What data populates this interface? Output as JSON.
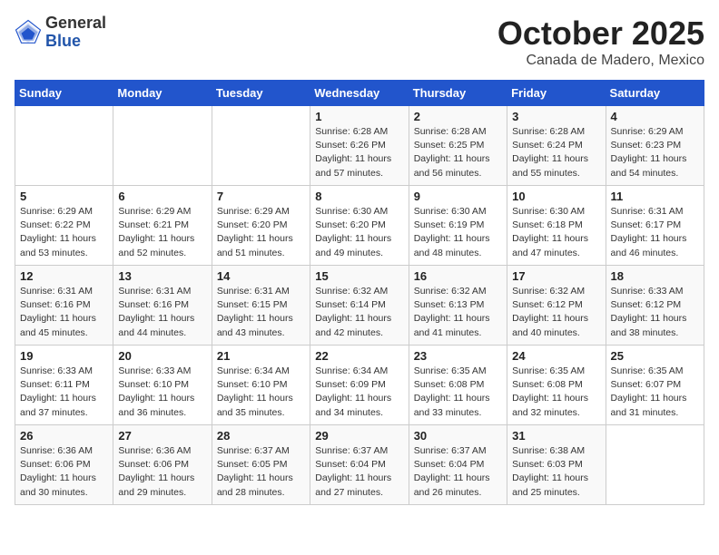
{
  "header": {
    "logo_general": "General",
    "logo_blue": "Blue",
    "month_title": "October 2025",
    "location": "Canada de Madero, Mexico"
  },
  "days_of_week": [
    "Sunday",
    "Monday",
    "Tuesday",
    "Wednesday",
    "Thursday",
    "Friday",
    "Saturday"
  ],
  "weeks": [
    [
      {
        "day": "",
        "info": ""
      },
      {
        "day": "",
        "info": ""
      },
      {
        "day": "",
        "info": ""
      },
      {
        "day": "1",
        "info": "Sunrise: 6:28 AM\nSunset: 6:26 PM\nDaylight: 11 hours and 57 minutes."
      },
      {
        "day": "2",
        "info": "Sunrise: 6:28 AM\nSunset: 6:25 PM\nDaylight: 11 hours and 56 minutes."
      },
      {
        "day": "3",
        "info": "Sunrise: 6:28 AM\nSunset: 6:24 PM\nDaylight: 11 hours and 55 minutes."
      },
      {
        "day": "4",
        "info": "Sunrise: 6:29 AM\nSunset: 6:23 PM\nDaylight: 11 hours and 54 minutes."
      }
    ],
    [
      {
        "day": "5",
        "info": "Sunrise: 6:29 AM\nSunset: 6:22 PM\nDaylight: 11 hours and 53 minutes."
      },
      {
        "day": "6",
        "info": "Sunrise: 6:29 AM\nSunset: 6:21 PM\nDaylight: 11 hours and 52 minutes."
      },
      {
        "day": "7",
        "info": "Sunrise: 6:29 AM\nSunset: 6:20 PM\nDaylight: 11 hours and 51 minutes."
      },
      {
        "day": "8",
        "info": "Sunrise: 6:30 AM\nSunset: 6:20 PM\nDaylight: 11 hours and 49 minutes."
      },
      {
        "day": "9",
        "info": "Sunrise: 6:30 AM\nSunset: 6:19 PM\nDaylight: 11 hours and 48 minutes."
      },
      {
        "day": "10",
        "info": "Sunrise: 6:30 AM\nSunset: 6:18 PM\nDaylight: 11 hours and 47 minutes."
      },
      {
        "day": "11",
        "info": "Sunrise: 6:31 AM\nSunset: 6:17 PM\nDaylight: 11 hours and 46 minutes."
      }
    ],
    [
      {
        "day": "12",
        "info": "Sunrise: 6:31 AM\nSunset: 6:16 PM\nDaylight: 11 hours and 45 minutes."
      },
      {
        "day": "13",
        "info": "Sunrise: 6:31 AM\nSunset: 6:16 PM\nDaylight: 11 hours and 44 minutes."
      },
      {
        "day": "14",
        "info": "Sunrise: 6:31 AM\nSunset: 6:15 PM\nDaylight: 11 hours and 43 minutes."
      },
      {
        "day": "15",
        "info": "Sunrise: 6:32 AM\nSunset: 6:14 PM\nDaylight: 11 hours and 42 minutes."
      },
      {
        "day": "16",
        "info": "Sunrise: 6:32 AM\nSunset: 6:13 PM\nDaylight: 11 hours and 41 minutes."
      },
      {
        "day": "17",
        "info": "Sunrise: 6:32 AM\nSunset: 6:12 PM\nDaylight: 11 hours and 40 minutes."
      },
      {
        "day": "18",
        "info": "Sunrise: 6:33 AM\nSunset: 6:12 PM\nDaylight: 11 hours and 38 minutes."
      }
    ],
    [
      {
        "day": "19",
        "info": "Sunrise: 6:33 AM\nSunset: 6:11 PM\nDaylight: 11 hours and 37 minutes."
      },
      {
        "day": "20",
        "info": "Sunrise: 6:33 AM\nSunset: 6:10 PM\nDaylight: 11 hours and 36 minutes."
      },
      {
        "day": "21",
        "info": "Sunrise: 6:34 AM\nSunset: 6:10 PM\nDaylight: 11 hours and 35 minutes."
      },
      {
        "day": "22",
        "info": "Sunrise: 6:34 AM\nSunset: 6:09 PM\nDaylight: 11 hours and 34 minutes."
      },
      {
        "day": "23",
        "info": "Sunrise: 6:35 AM\nSunset: 6:08 PM\nDaylight: 11 hours and 33 minutes."
      },
      {
        "day": "24",
        "info": "Sunrise: 6:35 AM\nSunset: 6:08 PM\nDaylight: 11 hours and 32 minutes."
      },
      {
        "day": "25",
        "info": "Sunrise: 6:35 AM\nSunset: 6:07 PM\nDaylight: 11 hours and 31 minutes."
      }
    ],
    [
      {
        "day": "26",
        "info": "Sunrise: 6:36 AM\nSunset: 6:06 PM\nDaylight: 11 hours and 30 minutes."
      },
      {
        "day": "27",
        "info": "Sunrise: 6:36 AM\nSunset: 6:06 PM\nDaylight: 11 hours and 29 minutes."
      },
      {
        "day": "28",
        "info": "Sunrise: 6:37 AM\nSunset: 6:05 PM\nDaylight: 11 hours and 28 minutes."
      },
      {
        "day": "29",
        "info": "Sunrise: 6:37 AM\nSunset: 6:04 PM\nDaylight: 11 hours and 27 minutes."
      },
      {
        "day": "30",
        "info": "Sunrise: 6:37 AM\nSunset: 6:04 PM\nDaylight: 11 hours and 26 minutes."
      },
      {
        "day": "31",
        "info": "Sunrise: 6:38 AM\nSunset: 6:03 PM\nDaylight: 11 hours and 25 minutes."
      },
      {
        "day": "",
        "info": ""
      }
    ]
  ]
}
